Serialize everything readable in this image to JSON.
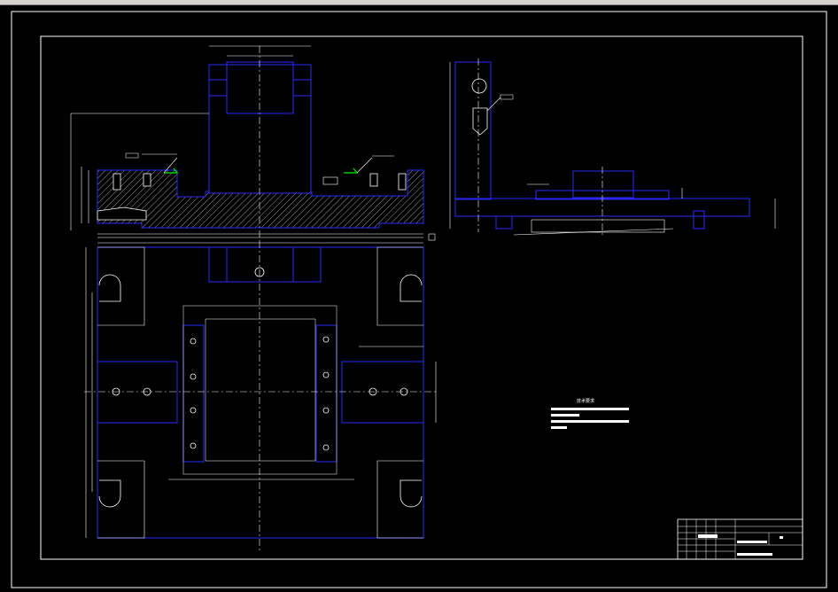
{
  "window": {
    "title_bar": "",
    "background": "#000000",
    "frame_color": "#d6d3ce"
  },
  "colors": {
    "outline": "#2a2aff",
    "center_line": "#ffffff",
    "dimension": "#ffffff",
    "hatch": "#ffffff",
    "weld_symbol": "#00c800",
    "border": "#ffffff"
  },
  "drawing": {
    "views": [
      "front-section-view",
      "side-view",
      "top-view"
    ],
    "technical_notes": {
      "title": "技术要求",
      "lines": [
        "",
        "",
        "",
        ""
      ]
    },
    "title_block": {
      "drawing_name": "",
      "material": "",
      "scale": "",
      "sheet": ""
    }
  }
}
